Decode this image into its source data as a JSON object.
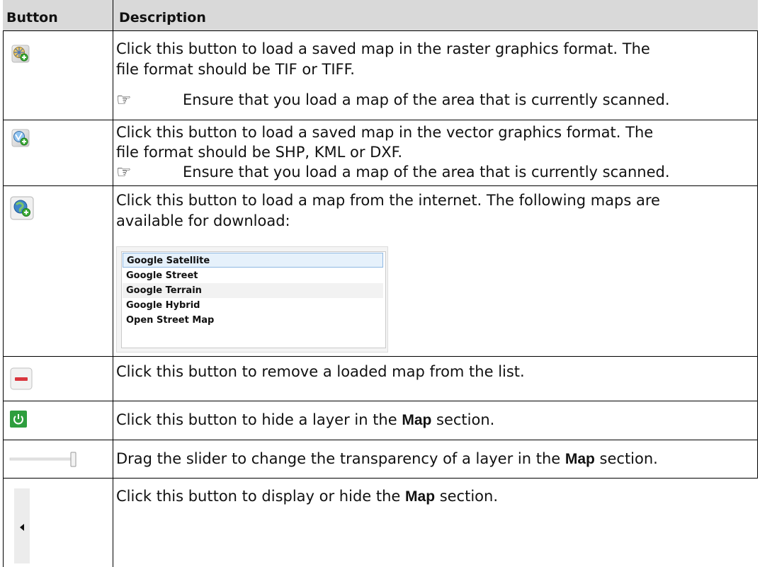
{
  "table": {
    "headers": {
      "button": "Button",
      "description": "Description"
    },
    "rows": [
      {
        "icon": "raster-map-add-icon",
        "lines": [
          "Click this button to load a saved map in the raster graphics format. The",
          "file format should be TIF or TIFF."
        ],
        "note": "Ensure that you load a map of the area that is currently scanned."
      },
      {
        "icon": "vector-map-add-icon",
        "lines": [
          "Click this button to load a saved map in the vector graphics format. The",
          "file format should be SHP, KML or DXF."
        ],
        "note": "Ensure that you load a map of the area that is currently scanned."
      },
      {
        "icon": "internet-map-add-icon",
        "lines": [
          "Click this button to load a map from the internet. The following maps are",
          "available for download:"
        ],
        "map_list": [
          "Google Satellite",
          "Google Street",
          "Google Terrain",
          "Google Hybrid",
          "Open Street Map"
        ],
        "selected_map": "Google Satellite"
      },
      {
        "icon": "remove-icon",
        "lines": [
          "Click this button to remove a loaded map from the list."
        ]
      },
      {
        "icon": "power-icon",
        "text_before": "Click this button to hide a layer in the ",
        "bold": "Map",
        "text_after": " section."
      },
      {
        "icon": "transparency-slider",
        "text_before": "Drag the slider to change the transparency of a layer in the ",
        "bold": "Map",
        "text_after": " section."
      },
      {
        "icon": "collapse-arrow-icon",
        "text_before": "Click this button to display or hide the ",
        "bold": "Map",
        "text_after": " section."
      }
    ]
  },
  "colors": {
    "header_bg": "#d9d9d9",
    "border": "#000000",
    "power_green": "#2e9e3e",
    "remove_red": "#d9363e"
  }
}
